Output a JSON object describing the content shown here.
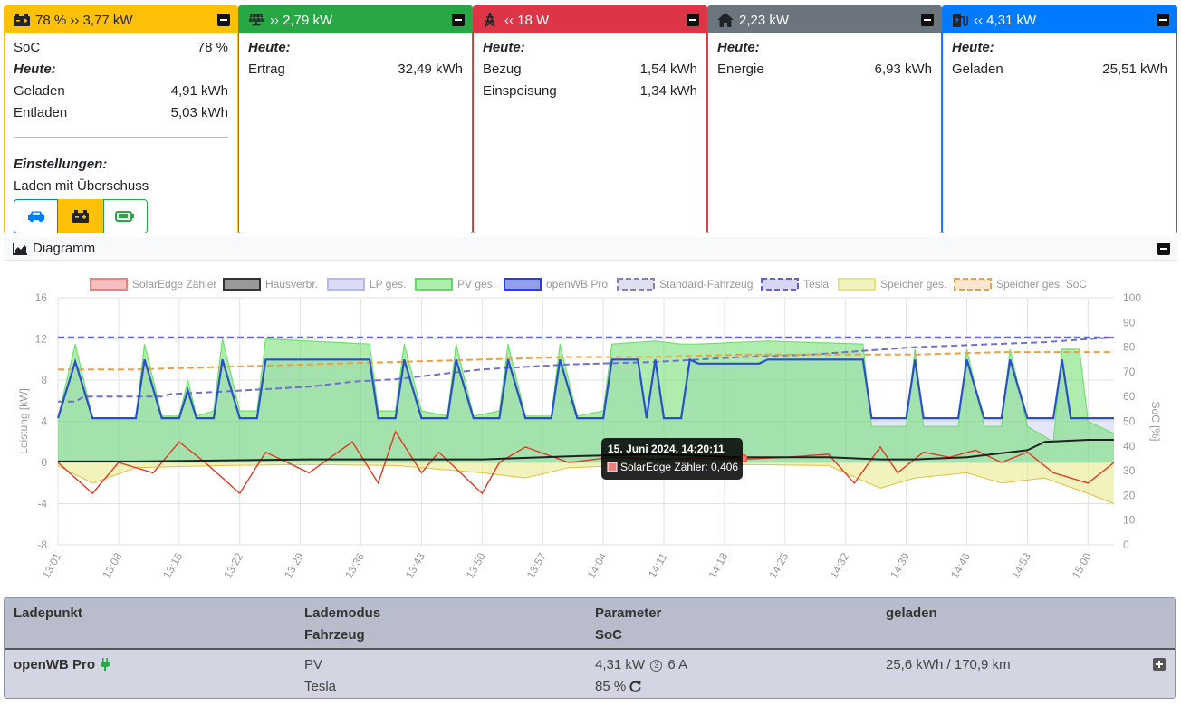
{
  "cards": {
    "battery": {
      "header": "78 % ›› 3,77 kW",
      "color": "#ffc107",
      "rows": [
        {
          "label": "SoC",
          "value": "78 %"
        }
      ],
      "today_label": "Heute:",
      "today_rows": [
        {
          "label": "Geladen",
          "value": "4,91 kWh"
        },
        {
          "label": "Entladen",
          "value": "5,03 kWh"
        }
      ],
      "settings_label": "Einstellungen:",
      "mode_text": "Laden mit Überschuss",
      "mode_buttons": [
        {
          "icon": "car-icon"
        },
        {
          "icon": "battery-icon",
          "active": true
        },
        {
          "icon": "battery-charging-icon"
        }
      ]
    },
    "pv": {
      "header": "›› 2,79 kW",
      "color": "#28a745",
      "today_label": "Heute:",
      "rows": [
        {
          "label": "Ertrag",
          "value": "32,49 kWh"
        }
      ]
    },
    "grid": {
      "header": "‹‹ 18 W",
      "color": "#dc3545",
      "today_label": "Heute:",
      "rows": [
        {
          "label": "Bezug",
          "value": "1,54 kWh"
        },
        {
          "label": "Einspeisung",
          "value": "1,34 kWh"
        }
      ]
    },
    "home": {
      "header": "2,23 kW",
      "color": "#6c757d",
      "today_label": "Heute:",
      "rows": [
        {
          "label": "Energie",
          "value": "6,93 kWh"
        }
      ]
    },
    "charge": {
      "header": "‹‹ 4,31 kW",
      "color": "#007bff",
      "today_label": "Heute:",
      "rows": [
        {
          "label": "Geladen",
          "value": "25,51 kWh"
        }
      ]
    }
  },
  "diagram": {
    "title": "Diagramm"
  },
  "chart_data": {
    "type": "line",
    "legend": [
      {
        "name": "SolarEdge Zähler",
        "color": "#f08080",
        "dashed": false
      },
      {
        "name": "Hausverbr.",
        "color": "#333333",
        "dashed": false
      },
      {
        "name": "LP ges.",
        "color": "#b8b8f0",
        "dashed": false
      },
      {
        "name": "PV ges.",
        "color": "#5fdc5f",
        "dashed": false
      },
      {
        "name": "openWB Pro",
        "color": "#2a3fd8",
        "dashed": false
      },
      {
        "name": "Standard-Fahrzeug",
        "color": "#8080c0",
        "dashed": true
      },
      {
        "name": "Tesla",
        "color": "#6060d8",
        "dashed": true
      },
      {
        "name": "Speicher ges.",
        "color": "#e6e680",
        "dashed": false
      },
      {
        "name": "Speicher ges. SoC",
        "color": "#f0a040",
        "dashed": true
      }
    ],
    "ylabel": "Leistung [kW]",
    "y2label": "SoC [%]",
    "ylim": [
      -8,
      16
    ],
    "y2lim": [
      0,
      100
    ],
    "yticks": [
      -8,
      -4,
      0,
      4,
      8,
      12,
      16
    ],
    "y2ticks": [
      0,
      10,
      20,
      30,
      40,
      50,
      60,
      70,
      80,
      90,
      100
    ],
    "xticks": [
      "13:01",
      "13:08",
      "13:15",
      "13:22",
      "13:29",
      "13:36",
      "13:43",
      "13:50",
      "13:57",
      "14:04",
      "14:11",
      "14:18",
      "14:25",
      "14:32",
      "14:39",
      "14:46",
      "14:53",
      "15:00"
    ],
    "x_minutes_start": 781,
    "x_minutes_end": 903,
    "series": [
      {
        "name": "openWB Pro",
        "axis": "y",
        "points": [
          [
            781,
            4.3
          ],
          [
            783,
            9.8
          ],
          [
            785,
            4.3
          ],
          [
            790,
            4.3
          ],
          [
            791,
            10
          ],
          [
            793,
            4.3
          ],
          [
            795,
            4.3
          ],
          [
            796,
            7
          ],
          [
            797,
            4.3
          ],
          [
            799,
            4.3
          ],
          [
            800,
            10
          ],
          [
            802,
            4.3
          ],
          [
            804,
            4.3
          ],
          [
            805,
            10
          ],
          [
            817,
            10
          ],
          [
            818,
            4.3
          ],
          [
            820,
            4.3
          ],
          [
            821,
            10
          ],
          [
            823,
            4.3
          ],
          [
            826,
            4.3
          ],
          [
            827,
            10
          ],
          [
            829,
            4.3
          ],
          [
            832,
            4.3
          ],
          [
            833,
            10
          ],
          [
            835,
            4.3
          ],
          [
            838,
            4.3
          ],
          [
            839,
            10
          ],
          [
            841,
            4.3
          ],
          [
            844,
            4.3
          ],
          [
            845,
            10
          ],
          [
            848,
            10
          ],
          [
            849,
            4.3
          ],
          [
            850,
            10
          ],
          [
            851,
            4.3
          ],
          [
            853,
            4.3
          ],
          [
            854,
            10
          ],
          [
            855,
            9.6
          ],
          [
            862,
            9.6
          ],
          [
            863,
            10
          ],
          [
            874,
            10
          ],
          [
            875,
            4.3
          ],
          [
            879,
            4.3
          ],
          [
            880,
            10
          ],
          [
            881,
            4.3
          ],
          [
            885,
            4.3
          ],
          [
            886,
            10
          ],
          [
            888,
            4.3
          ],
          [
            890,
            4.3
          ],
          [
            891,
            10
          ],
          [
            893,
            4.3
          ],
          [
            896,
            4.3
          ],
          [
            897,
            10
          ],
          [
            898,
            4.3
          ],
          [
            903,
            4.3
          ]
        ]
      },
      {
        "name": "PV ges.",
        "axis": "y",
        "points": [
          [
            781,
            4.3
          ],
          [
            783,
            11.5
          ],
          [
            785,
            4.3
          ],
          [
            790,
            4.3
          ],
          [
            791,
            11.5
          ],
          [
            793,
            4.5
          ],
          [
            795,
            4.5
          ],
          [
            796,
            8
          ],
          [
            797,
            4.5
          ],
          [
            799,
            5
          ],
          [
            800,
            12
          ],
          [
            802,
            5
          ],
          [
            804,
            5
          ],
          [
            805,
            12
          ],
          [
            817,
            11.5
          ],
          [
            818,
            5
          ],
          [
            820,
            5
          ],
          [
            821,
            11.5
          ],
          [
            823,
            5
          ],
          [
            826,
            4.5
          ],
          [
            827,
            11.5
          ],
          [
            829,
            4.5
          ],
          [
            832,
            5
          ],
          [
            833,
            11.5
          ],
          [
            835,
            4.5
          ],
          [
            838,
            4.5
          ],
          [
            839,
            11.5
          ],
          [
            841,
            4.5
          ],
          [
            844,
            5
          ],
          [
            845,
            11.5
          ],
          [
            850,
            11.8
          ],
          [
            853,
            11.5
          ],
          [
            855,
            11.5
          ],
          [
            863,
            11.8
          ],
          [
            874,
            11.5
          ],
          [
            875,
            3.5
          ],
          [
            879,
            3.5
          ],
          [
            880,
            11
          ],
          [
            881,
            3.5
          ],
          [
            885,
            3.5
          ],
          [
            886,
            11
          ],
          [
            888,
            3.5
          ],
          [
            890,
            3.5
          ],
          [
            891,
            11
          ],
          [
            893,
            3.5
          ],
          [
            896,
            2
          ],
          [
            897,
            11
          ],
          [
            899,
            11
          ],
          [
            900,
            4
          ],
          [
            903,
            2.8
          ]
        ]
      },
      {
        "name": "Hausverbr.",
        "axis": "y",
        "points": [
          [
            781,
            0.1
          ],
          [
            790,
            0.1
          ],
          [
            800,
            0.2
          ],
          [
            810,
            0.3
          ],
          [
            820,
            0.3
          ],
          [
            830,
            0.3
          ],
          [
            840,
            0.6
          ],
          [
            850,
            0.8
          ],
          [
            860,
            0.5
          ],
          [
            870,
            0.5
          ],
          [
            876,
            0.3
          ],
          [
            880,
            0.3
          ],
          [
            886,
            0.5
          ],
          [
            893,
            1.2
          ],
          [
            895,
            2
          ],
          [
            900,
            2.2
          ],
          [
            903,
            2.2
          ]
        ]
      },
      {
        "name": "Speicher ges.",
        "axis": "y",
        "points": [
          [
            781,
            -0.3
          ],
          [
            785,
            -2
          ],
          [
            790,
            -0.5
          ],
          [
            800,
            -0.3
          ],
          [
            810,
            -0.2
          ],
          [
            820,
            -0.3
          ],
          [
            830,
            -1
          ],
          [
            835,
            -1.5
          ],
          [
            840,
            -0.5
          ],
          [
            850,
            -0.2
          ],
          [
            860,
            -0.2
          ],
          [
            870,
            -0.3
          ],
          [
            876,
            -2.5
          ],
          [
            880,
            -1.5
          ],
          [
            886,
            -1
          ],
          [
            890,
            -2
          ],
          [
            895,
            -1.5
          ],
          [
            900,
            -3
          ],
          [
            903,
            -4
          ]
        ]
      },
      {
        "name": "SolarEdge Zähler",
        "axis": "y",
        "points": [
          [
            781,
            0
          ],
          [
            785,
            -3
          ],
          [
            788,
            0
          ],
          [
            792,
            -1
          ],
          [
            795,
            2
          ],
          [
            798,
            0
          ],
          [
            802,
            -3
          ],
          [
            805,
            1
          ],
          [
            810,
            -1
          ],
          [
            815,
            2
          ],
          [
            818,
            -2
          ],
          [
            820,
            3
          ],
          [
            823,
            -1
          ],
          [
            825,
            1
          ],
          [
            830,
            -3
          ],
          [
            832,
            0
          ],
          [
            835,
            1.5
          ],
          [
            840,
            0
          ],
          [
            845,
            0.5
          ],
          [
            850,
            0.3
          ],
          [
            855,
            0.4
          ],
          [
            860,
            0.3
          ],
          [
            865,
            0.5
          ],
          [
            870,
            0.8
          ],
          [
            873,
            -2
          ],
          [
            876,
            1.5
          ],
          [
            878,
            -1
          ],
          [
            881,
            1
          ],
          [
            884,
            0.5
          ],
          [
            887,
            1.2
          ],
          [
            890,
            0
          ],
          [
            893,
            1
          ],
          [
            896,
            -1
          ],
          [
            900,
            -2
          ],
          [
            903,
            0
          ]
        ]
      },
      {
        "name": "Speicher ges. SoC",
        "axis": "y2",
        "points": [
          [
            781,
            71
          ],
          [
            790,
            71
          ],
          [
            800,
            72
          ],
          [
            810,
            73
          ],
          [
            820,
            74
          ],
          [
            830,
            75
          ],
          [
            840,
            76
          ],
          [
            850,
            76
          ],
          [
            860,
            77
          ],
          [
            870,
            77
          ],
          [
            880,
            77
          ],
          [
            890,
            78
          ],
          [
            903,
            78
          ]
        ]
      },
      {
        "name": "Tesla",
        "axis": "y2",
        "points": [
          [
            781,
            84
          ],
          [
            903,
            84
          ]
        ]
      },
      {
        "name": "Standard-Fahrzeug",
        "axis": "y2",
        "points": [
          [
            781,
            58
          ],
          [
            783,
            58
          ],
          [
            784,
            60
          ],
          [
            793,
            60
          ],
          [
            794,
            61
          ],
          [
            800,
            62
          ],
          [
            805,
            63
          ],
          [
            810,
            64
          ],
          [
            815,
            66
          ],
          [
            820,
            67
          ],
          [
            825,
            69
          ],
          [
            830,
            71
          ],
          [
            835,
            72
          ],
          [
            840,
            73
          ],
          [
            850,
            74
          ],
          [
            860,
            76
          ],
          [
            868,
            77
          ],
          [
            880,
            80
          ],
          [
            895,
            82
          ],
          [
            903,
            84
          ]
        ]
      }
    ],
    "tooltip": {
      "title": "15. Juni 2024, 14:20:11",
      "label": "SolarEdge Zähler: 0,406",
      "x": 860.2,
      "y": 0.406
    }
  },
  "table": {
    "headers": {
      "ladepunkt": "Ladepunkt",
      "lademodus": "Lademodus",
      "fahrzeug": "Fahrzeug",
      "parameter": "Parameter",
      "soc": "SoC",
      "geladen": "geladen"
    },
    "rows": [
      {
        "name": "openWB Pro",
        "mode": "PV",
        "vehicle": "Tesla",
        "power": "4,31 kW",
        "phases": "3",
        "current": "6 A",
        "soc": "85 %",
        "charged": "25,6 kWh / 170,9 km"
      }
    ]
  }
}
